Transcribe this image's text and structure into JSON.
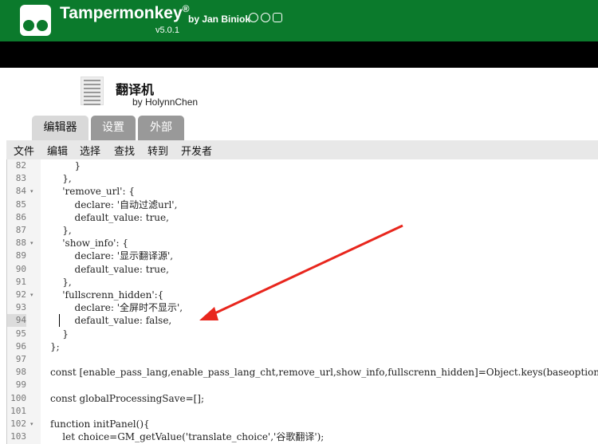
{
  "app": {
    "name": "Tampermonkey",
    "reg": "®",
    "byline": "by Jan Biniok",
    "version": "v5.0.1"
  },
  "script": {
    "name": "翻译机",
    "author": "by HolynnChen"
  },
  "tabs": [
    {
      "label": "编辑器"
    },
    {
      "label": "设置"
    },
    {
      "label": "外部"
    }
  ],
  "menu": [
    {
      "label": "文件"
    },
    {
      "label": "编辑"
    },
    {
      "label": "选择"
    },
    {
      "label": "查找"
    },
    {
      "label": "转到"
    },
    {
      "label": "开发者"
    }
  ],
  "code_lines": [
    {
      "no": "82",
      "fold": "",
      "text": "        }"
    },
    {
      "no": "83",
      "fold": "",
      "text": "    },"
    },
    {
      "no": "84",
      "fold": "▾",
      "text": "    'remove_url': {"
    },
    {
      "no": "85",
      "fold": "",
      "text": "        declare: '自动过滤url',"
    },
    {
      "no": "86",
      "fold": "",
      "text": "        default_value: true,"
    },
    {
      "no": "87",
      "fold": "",
      "text": "    },"
    },
    {
      "no": "88",
      "fold": "▾",
      "text": "    'show_info': {"
    },
    {
      "no": "89",
      "fold": "",
      "text": "        declare: '显示翻译源',"
    },
    {
      "no": "90",
      "fold": "",
      "text": "        default_value: true,"
    },
    {
      "no": "91",
      "fold": "",
      "text": "    },"
    },
    {
      "no": "92",
      "fold": "▾",
      "text": "    'fullscrenn_hidden':{"
    },
    {
      "no": "93",
      "fold": "",
      "text": "        declare: '全屏时不显示',"
    },
    {
      "no": "94",
      "fold": "",
      "text": "        default_value: false,"
    },
    {
      "no": "95",
      "fold": "",
      "text": "    }"
    },
    {
      "no": "96",
      "fold": "",
      "text": "};"
    },
    {
      "no": "97",
      "fold": "",
      "text": ""
    },
    {
      "no": "98",
      "fold": "",
      "text": "const [enable_pass_lang,enable_pass_lang_cht,remove_url,show_info,fullscrenn_hidden]=Object.keys(baseoptions).m"
    },
    {
      "no": "99",
      "fold": "",
      "text": ""
    },
    {
      "no": "100",
      "fold": "",
      "text": "const globalProcessingSave=[];"
    },
    {
      "no": "101",
      "fold": "",
      "text": ""
    },
    {
      "no": "102",
      "fold": "▾",
      "text": "function initPanel(){"
    },
    {
      "no": "103",
      "fold": "",
      "text": "    let choice=GM_getValue('translate_choice','谷歌翻译');"
    }
  ],
  "active_line": "94"
}
